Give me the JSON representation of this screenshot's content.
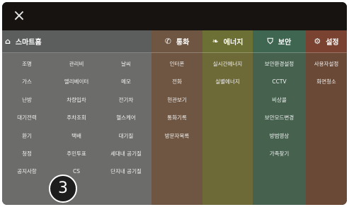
{
  "topbar": {
    "close_icon": "×"
  },
  "columns": {
    "smart": {
      "title": "스마트홈",
      "icon": "home-icon"
    },
    "call": {
      "title": "통화",
      "icon": "phone-icon"
    },
    "energy": {
      "title": "에너지",
      "icon": "leaf-icon"
    },
    "sec": {
      "title": "보안",
      "icon": "shield-icon"
    },
    "set": {
      "title": "설정",
      "icon": "gear-icon"
    }
  },
  "smart_items": [
    [
      "조명",
      "관리비",
      "날씨"
    ],
    [
      "가스",
      "엘리베이터",
      "메모"
    ],
    [
      "난방",
      "차량입차",
      "전기차"
    ],
    [
      "대기전력",
      "주차조회",
      "헬스케어"
    ],
    [
      "환기",
      "택배",
      "대기질"
    ],
    [
      "청정",
      "주민투표",
      "세대내 공기질"
    ],
    [
      "공지사항",
      "CS",
      "단지내 공기질"
    ]
  ],
  "call_items": [
    "인터폰",
    "전화",
    "현관보기",
    "통화기록",
    "방문자목록"
  ],
  "energy_items": [
    "실시간에너지",
    "실별에너지"
  ],
  "sec_items": [
    "보안환경설정",
    "CCTV",
    "비상콜",
    "보안모드변경",
    "방범영상",
    "가족찾기"
  ],
  "set_items": [
    "사용자설정",
    "화면청소"
  ],
  "badge": "3",
  "colors": {
    "smart": "#6c6d6a",
    "call": "#6e5642",
    "energy": "#6d6a38",
    "security": "#46624f",
    "settings": "#6a4936"
  }
}
